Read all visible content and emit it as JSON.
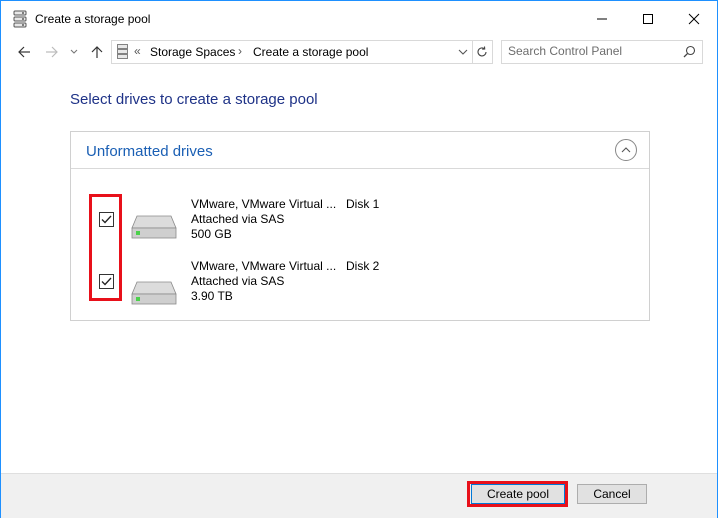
{
  "window": {
    "title": "Create a storage pool",
    "minimize_glyph": "—",
    "maximize_glyph": "☐",
    "close_glyph": "✕"
  },
  "nav": {
    "back_glyph": "←",
    "forward_glyph": "→",
    "recent_glyph": "⌄",
    "up_glyph": "↑",
    "breadcrumb_prefix": "«",
    "breadcrumbs": [
      "Storage Spaces",
      "Create a storage pool"
    ],
    "breadcrumb_separator": "›",
    "dropdown_glyph": "⌄",
    "refresh_glyph": "↻",
    "search_placeholder": "Search Control Panel"
  },
  "main": {
    "heading": "Select drives to create a storage pool",
    "section_title": "Unformatted drives",
    "collapse_glyph": "︿",
    "drives": [
      {
        "name": "VMware, VMware Virtual ...",
        "attachment": "Attached via SAS",
        "size": "500 GB",
        "disk": "Disk 1",
        "checked": true
      },
      {
        "name": "VMware, VMware Virtual ...",
        "attachment": "Attached via SAS",
        "size": "3.90 TB",
        "disk": "Disk 2",
        "checked": true
      }
    ]
  },
  "footer": {
    "create_label": "Create pool",
    "cancel_label": "Cancel"
  },
  "colors": {
    "heading": "#1e3287",
    "section_title": "#1a5fb4",
    "highlight": "#e8101a",
    "window_border": "#1e90ff"
  },
  "icons": {
    "title": "storage-spaces-icon",
    "disk": "hard-drive-icon",
    "search": "search-icon"
  }
}
